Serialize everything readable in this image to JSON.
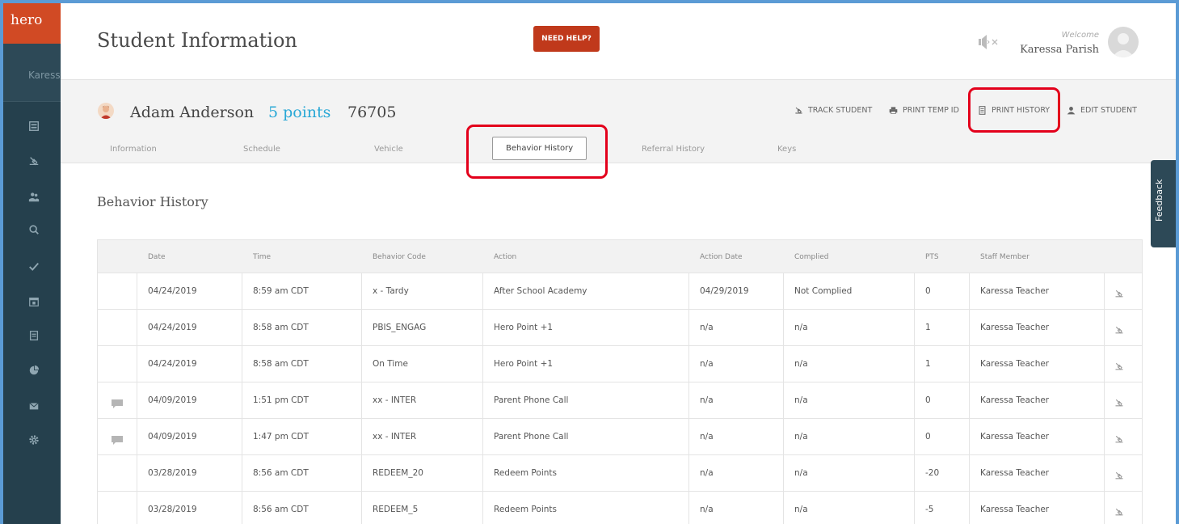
{
  "app": {
    "logo": "hero",
    "sidebar_user": "Karessa"
  },
  "sidebar": {
    "icons": [
      "dashboard-icon",
      "track-icon",
      "students-icon",
      "search-icon",
      "check-icon",
      "calendar-icon",
      "report-icon",
      "pie-chart-icon",
      "mail-icon",
      "settings-icon"
    ]
  },
  "header": {
    "title": "Student Information",
    "help_label": "NEED HELP?",
    "welcome": "Welcome",
    "username": "Karessa Parish"
  },
  "student": {
    "name": "Adam Anderson",
    "points": "5 points",
    "id": "76705"
  },
  "actions": {
    "track": "TRACK STUDENT",
    "print_temp": "PRINT TEMP ID",
    "print_history": "PRINT HISTORY",
    "edit": "EDIT STUDENT"
  },
  "tabs": {
    "information": "Information",
    "schedule": "Schedule",
    "vehicle": "Vehicle",
    "behavior_history": "Behavior History",
    "referral_history": "Referral History",
    "keys": "Keys"
  },
  "section": {
    "title": "Behavior History"
  },
  "feedback": "Feedback",
  "table": {
    "columns": [
      "Date",
      "Time",
      "Behavior Code",
      "Action",
      "Action Date",
      "Complied",
      "PTS",
      "Staff Member"
    ],
    "rows": [
      {
        "comment": false,
        "date": "04/24/2019",
        "time": "8:59 am CDT",
        "code": "x - Tardy",
        "action": "After School Academy",
        "action_date": "04/29/2019",
        "complied": "Not Complied",
        "pts": "0",
        "staff": "Karessa Teacher"
      },
      {
        "comment": false,
        "date": "04/24/2019",
        "time": "8:58 am CDT",
        "code": "PBIS_ENGAG",
        "action": "Hero Point +1",
        "action_date": "n/a",
        "complied": "n/a",
        "pts": "1",
        "staff": "Karessa Teacher"
      },
      {
        "comment": false,
        "date": "04/24/2019",
        "time": "8:58 am CDT",
        "code": "On Time",
        "action": "Hero Point +1",
        "action_date": "n/a",
        "complied": "n/a",
        "pts": "1",
        "staff": "Karessa Teacher"
      },
      {
        "comment": true,
        "date": "04/09/2019",
        "time": "1:51 pm CDT",
        "code": "xx - INTER",
        "action": "Parent Phone Call",
        "action_date": "n/a",
        "complied": "n/a",
        "pts": "0",
        "staff": "Karessa Teacher"
      },
      {
        "comment": true,
        "date": "04/09/2019",
        "time": "1:47 pm CDT",
        "code": "xx - INTER",
        "action": "Parent Phone Call",
        "action_date": "n/a",
        "complied": "n/a",
        "pts": "0",
        "staff": "Karessa Teacher"
      },
      {
        "comment": false,
        "date": "03/28/2019",
        "time": "8:56 am CDT",
        "code": "REDEEM_20",
        "action": "Redeem Points",
        "action_date": "n/a",
        "complied": "n/a",
        "pts": "-20",
        "staff": "Karessa Teacher"
      },
      {
        "comment": false,
        "date": "03/28/2019",
        "time": "8:56 am CDT",
        "code": "REDEEM_5",
        "action": "Redeem Points",
        "action_date": "n/a",
        "complied": "n/a",
        "pts": "-5",
        "staff": "Karessa Teacher"
      }
    ]
  },
  "colors": {
    "sidebar": "#25404d",
    "brand": "#d14a24",
    "help_button": "#c0391b",
    "points": "#29a8d6",
    "highlight": "#e3001b"
  }
}
